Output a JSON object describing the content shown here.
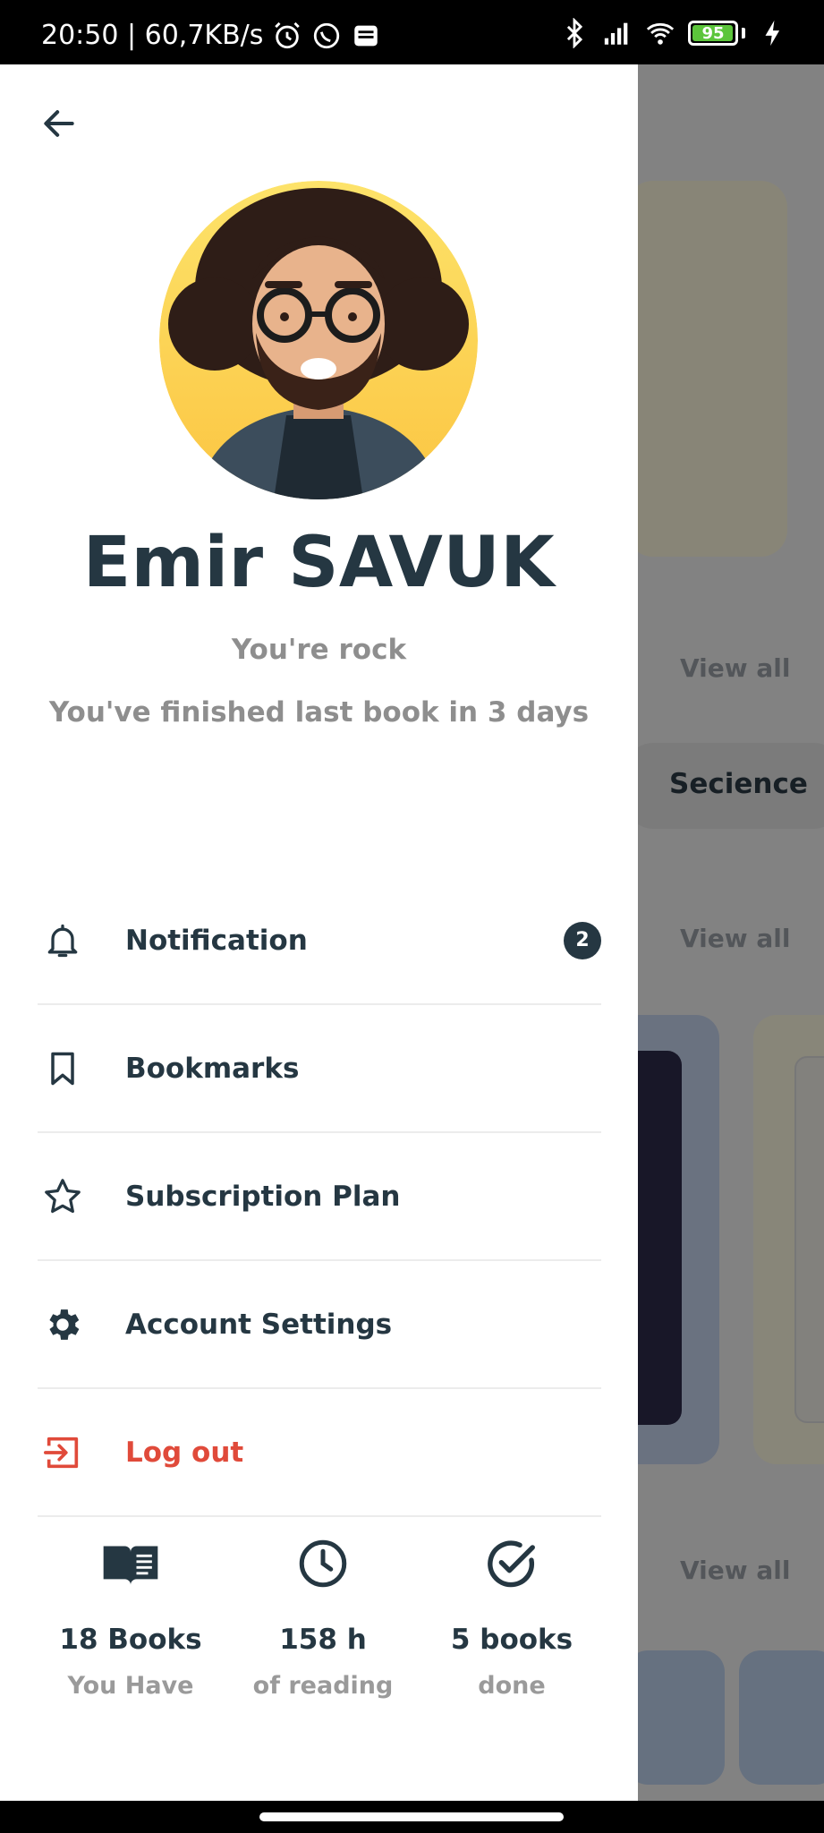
{
  "status_bar": {
    "time_speed": "20:50 | 60,7KB/s",
    "battery": "95"
  },
  "background": {
    "view_all_1": "View all",
    "view_all_2": "View all",
    "view_all_3": "View all",
    "chip_label": "Secience"
  },
  "profile": {
    "name": "Emir SAVUK",
    "tagline": "You're rock",
    "subline": "You've finished last book in 3 days"
  },
  "menu": {
    "items": [
      {
        "label": "Notification",
        "icon": "bell-icon",
        "badge": "2"
      },
      {
        "label": "Bookmarks",
        "icon": "bookmark-icon"
      },
      {
        "label": "Subscription Plan",
        "icon": "star-icon"
      },
      {
        "label": "Account Settings",
        "icon": "gear-icon"
      },
      {
        "label": "Log out",
        "icon": "logout-icon"
      }
    ]
  },
  "stats": [
    {
      "value": "18 Books",
      "label": "You Have",
      "icon": "open-book-icon"
    },
    {
      "value": "158 h",
      "label": "of reading",
      "icon": "clock-icon"
    },
    {
      "value": "5 books",
      "label": "done",
      "icon": "check-circle-icon"
    }
  ],
  "colors": {
    "primary": "#253742",
    "logout": "#e04a3a",
    "muted": "#8e8e8e"
  }
}
